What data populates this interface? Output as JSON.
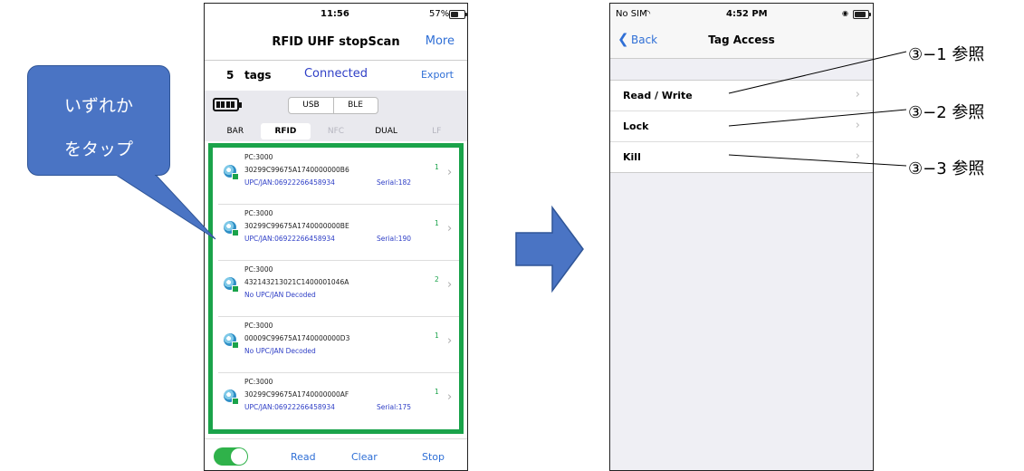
{
  "phone1": {
    "status": {
      "time": "11:56",
      "battery": "57%"
    },
    "nav": {
      "title": "RFID UHF stopScan",
      "more": "More"
    },
    "header": {
      "count": "5",
      "tags_word": "tags",
      "connection": "Connected",
      "export": "Export"
    },
    "interface": {
      "usb": "USB",
      "ble": "BLE"
    },
    "tabs": [
      "BAR",
      "RFID",
      "NFC",
      "DUAL",
      "LF"
    ],
    "rows": [
      {
        "pc": "PC:3000",
        "epc": "30299C99675A1740000000B6",
        "upc": "UPC/JAN:06922266458934",
        "serial": "Serial:182",
        "count": "1"
      },
      {
        "pc": "PC:3000",
        "epc": "30299C99675A1740000000BE",
        "upc": "UPC/JAN:06922266458934",
        "serial": "Serial:190",
        "count": "1"
      },
      {
        "pc": "PC:3000",
        "epc": "432143213021C1400001046A",
        "upc": "No UPC/JAN Decoded",
        "serial": "",
        "count": "2"
      },
      {
        "pc": "PC:3000",
        "epc": "00009C99675A1740000000D3",
        "upc": "No UPC/JAN Decoded",
        "serial": "",
        "count": "1"
      },
      {
        "pc": "PC:3000",
        "epc": "30299C99675A1740000000AF",
        "upc": "UPC/JAN:06922266458934",
        "serial": "Serial:175",
        "count": "1"
      }
    ],
    "toolbar": {
      "read": "Read",
      "clear": "Clear",
      "stop": "Stop"
    }
  },
  "phone2": {
    "status": {
      "carrier": "No SIM",
      "time": "4:52 PM"
    },
    "nav": {
      "back": "Back",
      "title": "Tag Access"
    },
    "menu": [
      "Read / Write",
      "Lock",
      "Kill"
    ]
  },
  "callout": {
    "line1": "いずれか",
    "line2": "をタップ"
  },
  "refs": [
    "③−1 参照",
    "③−2 参照",
    "③−3 参照"
  ],
  "colors": {
    "accent": "#2f6fd6",
    "highlight": "#1aa34a",
    "callout": "#4a74c4"
  }
}
